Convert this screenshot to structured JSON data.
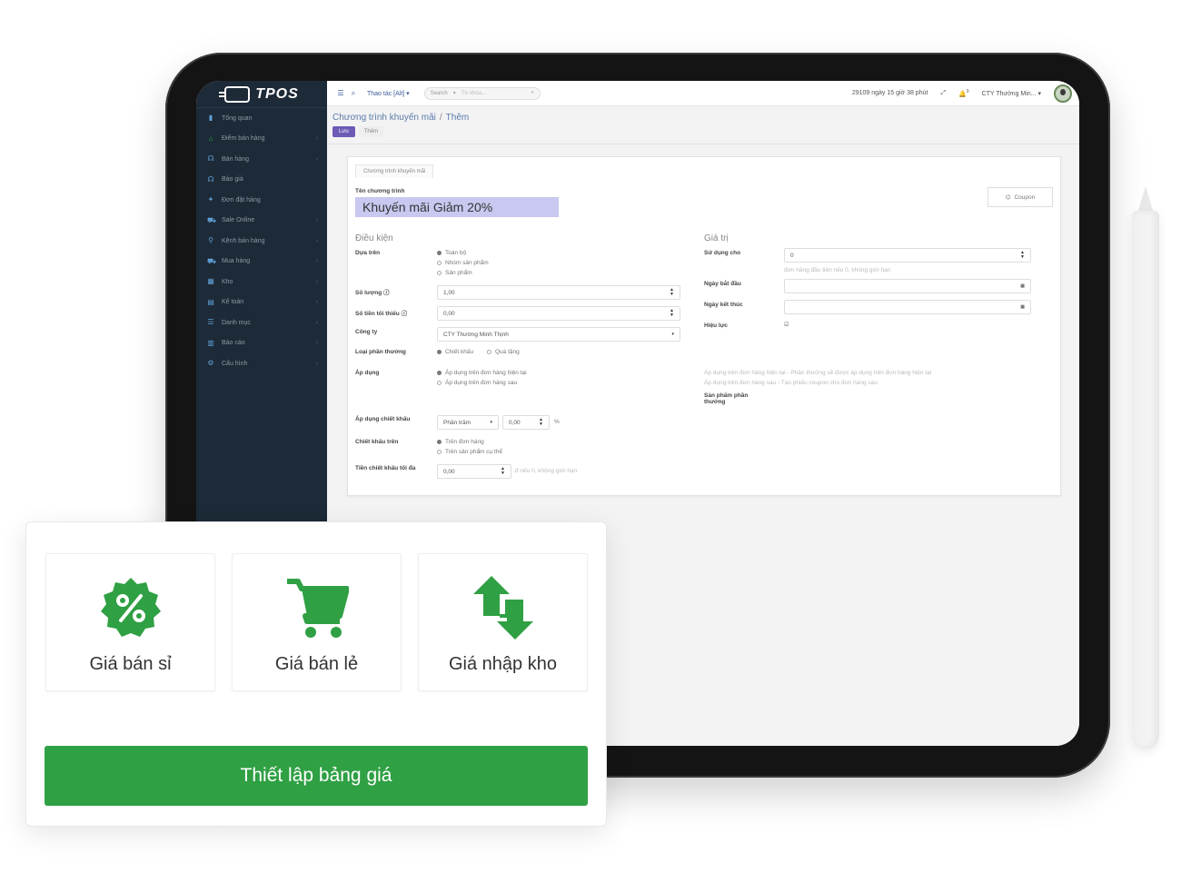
{
  "app": {
    "logo": "TPOS"
  },
  "sidebar": {
    "items": [
      {
        "label": "Tổng quan",
        "icon": "chart-icon"
      },
      {
        "label": "Điểm bán hàng",
        "icon": "store-icon"
      },
      {
        "label": "Bán hàng",
        "icon": "headset-icon"
      },
      {
        "label": "Báo giá",
        "icon": "headset-icon"
      },
      {
        "label": "Đơn đặt hàng",
        "icon": "pin-icon"
      },
      {
        "label": "Sale Online",
        "icon": "cart-icon"
      },
      {
        "label": "Kênh bán hàng",
        "icon": "link-icon"
      },
      {
        "label": "Mua hàng",
        "icon": "cart-icon"
      },
      {
        "label": "Kho",
        "icon": "grid-icon"
      },
      {
        "label": "Kế toán",
        "icon": "doc-icon"
      },
      {
        "label": "Danh mục",
        "icon": "list-icon"
      },
      {
        "label": "Báo cáo",
        "icon": "bar-icon"
      },
      {
        "label": "Cấu hình",
        "icon": "gears-icon"
      }
    ]
  },
  "topbar": {
    "action": "Thao tác [Alt] ▾",
    "search_scope": "Search",
    "search_placeholder": "Từ khóa...",
    "trial": "29109 ngày 15 giờ 38 phút",
    "notif_count": "0",
    "company": "CTY Thường Min... ▾"
  },
  "breadcrumb": {
    "parent": "Chương trình khuyến mãi",
    "current": "Thêm"
  },
  "buttons": {
    "save": "Lưu",
    "add": "Thêm"
  },
  "form": {
    "tab": "Chương trình khuyến mãi",
    "name_label": "Tên chương trình",
    "name_value": "Khuyến mãi Giảm 20%",
    "coupon": "Coupon",
    "conditions_title": "Điều kiện",
    "based_on_label": "Dựa trên",
    "based_on_options": [
      "Toàn bộ",
      "Nhóm sản phẩm",
      "Sản phẩm"
    ],
    "qty_label": "Số lượng",
    "qty_value": "1,00",
    "min_amount_label": "Số tiền tối thiểu",
    "min_amount_value": "0,00",
    "company_label": "Công ty",
    "company_value": "CTY Thường Minh Thịnh",
    "reward_type_label": "Loại phần thưởng",
    "reward_type_options": [
      "Chiết khấu",
      "Quà tặng"
    ],
    "apply_label": "Áp dụng",
    "apply_options": [
      "Áp dụng trên đơn hàng hiện tại",
      "Áp dụng trên đơn hàng sau"
    ],
    "discount_apply_label": "Áp dụng chiết khấu",
    "discount_type": "Phần trăm",
    "discount_value": "0,00",
    "discount_unit": "%",
    "discount_on_label": "Chiết khấu trên",
    "discount_on_options": [
      "Trên đơn hàng",
      "Trên sản phẩm cụ thể"
    ],
    "max_discount_label": "Tiền chiết khấu tối đa",
    "max_discount_value": "0,00",
    "max_discount_hint": "đ nếu 0, không giới hạn",
    "value_title": "Giá trị",
    "use_for_label": "Sử dụng cho",
    "use_for_value": "0",
    "use_for_hint": "đơn hàng đầu tiên nếu 0, không giới hạn",
    "start_label": "Ngày bắt đầu",
    "end_label": "Ngày kết thúc",
    "active_label": "Hiệu lực",
    "note_1": "Áp dụng trên đơn hàng hiện tại - Phần thưởng sẽ được áp dụng trên đơn hàng hiện tại",
    "note_2": "Áp dụng trên đơn hàng sau - Tạo phiếu coupon cho đơn hàng sau",
    "reward_product_label": "Sản phẩm phần thưởng"
  },
  "overlay": {
    "tiles": [
      {
        "label": "Giá bán sỉ",
        "icon": "percent-badge-icon"
      },
      {
        "label": "Giá bán lẻ",
        "icon": "shopping-cart-icon"
      },
      {
        "label": "Giá nhập kho",
        "icon": "swap-arrows-icon"
      }
    ],
    "cta": "Thiết lập bảng giá"
  },
  "colors": {
    "accent_green": "#2fa043",
    "sidebar": "#1d2a37",
    "save_button": "#6d5bb6"
  }
}
